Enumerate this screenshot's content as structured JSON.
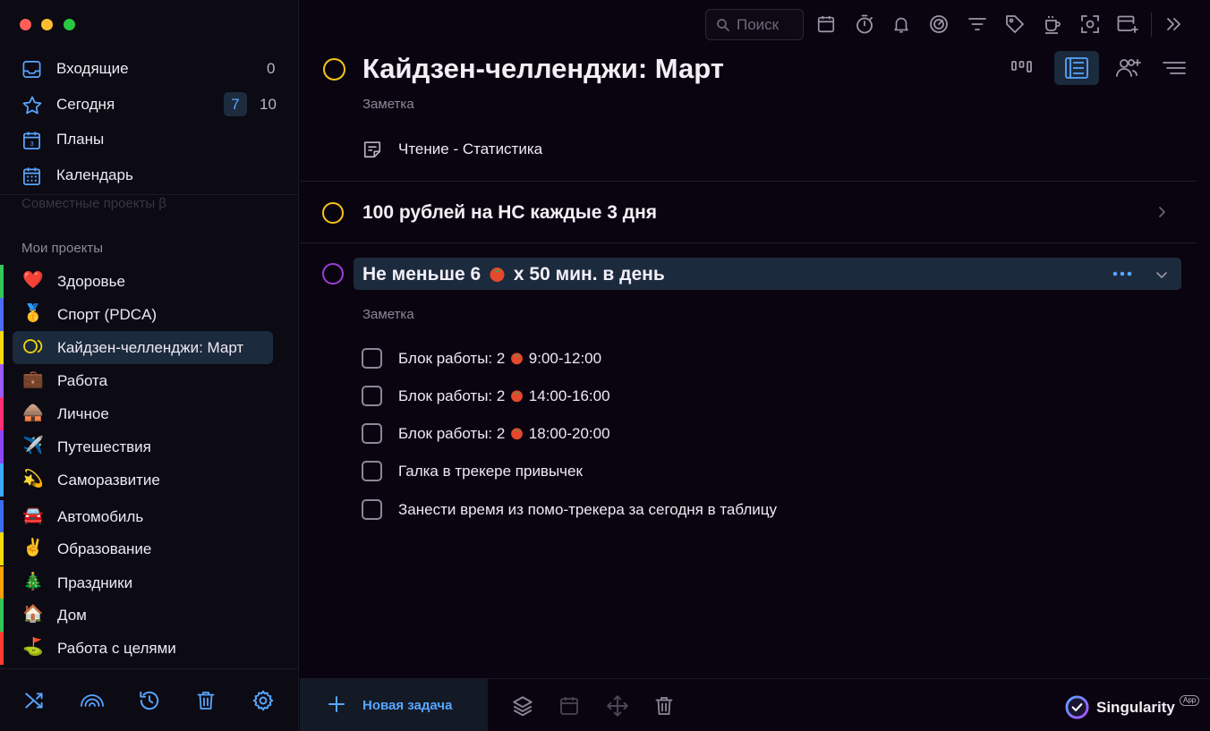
{
  "sidebar": {
    "nav": [
      {
        "label": "Входящие",
        "icon": "inbox-icon",
        "count": "0"
      },
      {
        "label": "Сегодня",
        "icon": "star-icon",
        "badge": "7",
        "count": "10"
      },
      {
        "label": "Планы",
        "icon": "calendar-day-icon",
        "icon_text": "3"
      },
      {
        "label": "Календарь",
        "icon": "calendar-grid-icon"
      }
    ],
    "shared_projects_label": "Совместные проекты β",
    "my_projects_label": "Мои проекты",
    "projects": [
      {
        "emoji": "❤️",
        "label": "Здоровье",
        "color": "#34c759"
      },
      {
        "emoji": "🥇",
        "label": "Спорт (PDCA)",
        "color": "#4b6cf7"
      },
      {
        "emoji": "◯",
        "label": "Кайдзен-челленджи: Март",
        "color": "#f5d90a",
        "active": true
      },
      {
        "emoji": "💼",
        "label": "Работа",
        "color": "#9b59ff"
      },
      {
        "emoji": "🛖",
        "label": "Личное",
        "color": "#ff2d75"
      },
      {
        "emoji": "✈️",
        "label": "Путешествия",
        "color": "#8e44ff"
      },
      {
        "emoji": "💫",
        "label": "Саморазвитие",
        "color": "#3fa9ff"
      },
      {
        "emoji": "🚘",
        "label": "Автомобиль",
        "color": "#3b6cf2"
      },
      {
        "emoji": "✌️",
        "label": "Образование",
        "color": "#f5d90a"
      },
      {
        "emoji": "🎄",
        "label": "Праздники",
        "color": "#ff9f0a"
      },
      {
        "emoji": "🏠",
        "label": "Дом",
        "color": "#34c759"
      },
      {
        "emoji": "⛳",
        "label": "Работа с целями",
        "color": "#ff3b30"
      }
    ],
    "tools": [
      "shuffle-icon",
      "rainbow-icon",
      "history-icon",
      "trash-icon",
      "settings-icon"
    ]
  },
  "toolbar": {
    "search_placeholder": "Поиск",
    "icons": [
      "calendar-icon",
      "timer-icon",
      "bell-icon",
      "focus-icon",
      "filter-icon",
      "tag-icon",
      "coffee-icon",
      "screenshot-icon",
      "add-window-icon",
      "collapse-icon"
    ]
  },
  "tasks": [
    {
      "title": "Кайдзен-челленджи: Март",
      "note_label": "Заметка",
      "subitems": [
        {
          "text": "Чтение - Статистика",
          "icon": "note-icon"
        }
      ]
    },
    {
      "title": "100 рублей на НС каждые 3 дня"
    },
    {
      "title_prefix": "Не меньше 6",
      "title_suffix": "х 50 мин. в день",
      "note_label": "Заметка",
      "checklist": [
        {
          "prefix": "Блок работы: 2",
          "suffix": "9:00-12:00",
          "checked": false
        },
        {
          "prefix": "Блок работы: 2",
          "suffix": "14:00-16:00",
          "checked": false
        },
        {
          "prefix": "Блок работы: 2",
          "suffix": "18:00-20:00",
          "checked": false
        },
        {
          "prefix": "Галка в трекере привычек",
          "suffix": "",
          "checked": false
        },
        {
          "prefix": "Занести время из помо-трекера за сегодня в таблицу",
          "suffix": "",
          "checked": false
        }
      ]
    }
  ],
  "bottom_bar": {
    "new_task_label": "Новая задача",
    "brand_name": "Singularity",
    "brand_badge": "App"
  },
  "colors": {
    "accent": "#58a6ff",
    "priority_yellow": "#f5c518",
    "priority_purple": "#9b3fd6"
  }
}
